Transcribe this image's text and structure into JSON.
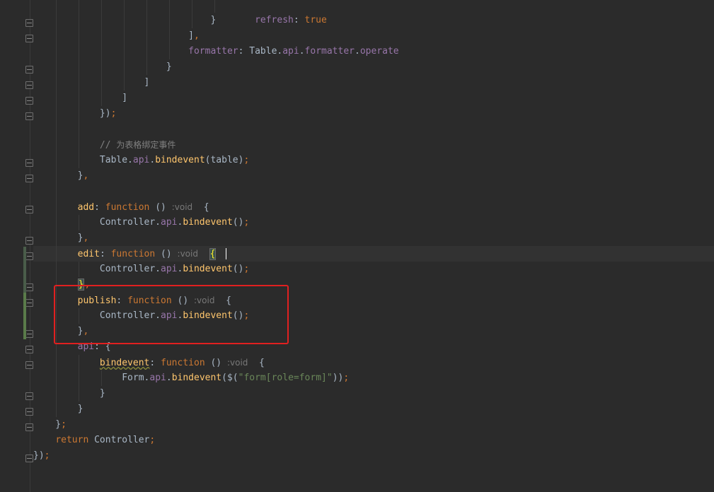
{
  "editor": {
    "language": "javascript",
    "comment_text": "为表格绑定事件",
    "highlighted_method": "publish",
    "current_line_method": "edit",
    "colors": {
      "background": "#2b2b2b",
      "keyword": "#cc7832",
      "property": "#9876aa",
      "function_name": "#ffc66d",
      "string": "#6a8759",
      "comment": "#808080",
      "highlight_box": "#e02020"
    },
    "lines": [
      "                        refresh: true",
      "                    }",
      "                ],",
      "                formatter: Table.api.formatter.operate",
      "            }",
      "        ]",
      "    ]",
      "});",
      "",
      "// 为表格绑定事件",
      "Table.api.bindevent(table);",
      "},",
      "",
      "add: function () :void  {",
      "    Controller.api.bindevent();",
      "},",
      "edit: function () :void  {",
      "    Controller.api.bindevent();",
      "},",
      "publish: function () :void  {",
      "    Controller.api.bindevent();",
      "},",
      "api: {",
      "    bindevent: function () :void  {",
      "        Form.api.bindevent($(\"form[role=form]\"));",
      "    }",
      "}",
      "};",
      "return Controller;",
      "});"
    ]
  }
}
